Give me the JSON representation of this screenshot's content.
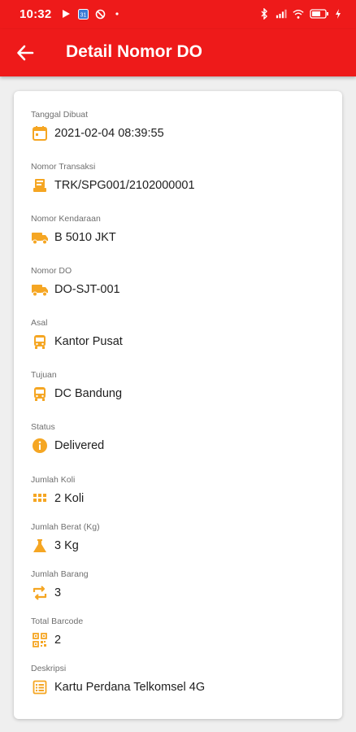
{
  "status_bar": {
    "time": "10:32",
    "left_icons": [
      "play-store-icon",
      "calendar-notification-icon",
      "block-icon",
      "dot-icon"
    ],
    "right_icons": [
      "bluetooth-icon",
      "signal-icon",
      "wifi-icon",
      "battery-icon",
      "charging-icon"
    ]
  },
  "app_bar": {
    "title": "Detail Nomor DO",
    "back_icon": "arrow-left-icon"
  },
  "colors": {
    "primary": "#ee1a1a",
    "icon_accent": "#f5a623",
    "label": "#6f6f6f",
    "value": "#1e1e1e"
  },
  "fields": [
    {
      "label": "Tanggal Dibuat",
      "value": "2021-02-04 08:39:55",
      "icon": "calendar-icon"
    },
    {
      "label": "Nomor Transaksi",
      "value": "TRK/SPG001/2102000001",
      "icon": "receipt-icon"
    },
    {
      "label": "Nomor Kendaraan",
      "value": "B 5010 JKT",
      "icon": "truck-icon"
    },
    {
      "label": "Nomor DO",
      "value": "DO-SJT-001",
      "icon": "truck-icon"
    },
    {
      "label": "Asal",
      "value": "Kantor Pusat",
      "icon": "bus-icon"
    },
    {
      "label": "Tujuan",
      "value": "DC Bandung",
      "icon": "bus-icon"
    },
    {
      "label": "Status",
      "value": "Delivered",
      "icon": "info-icon"
    },
    {
      "label": "Jumlah Koli",
      "value": "2 Koli",
      "icon": "grid-icon"
    },
    {
      "label": "Jumlah Berat (Kg)",
      "value": "3 Kg",
      "icon": "flask-icon"
    },
    {
      "label": "Jumlah Barang",
      "value": "3",
      "icon": "swap-icon"
    },
    {
      "label": "Total Barcode",
      "value": "2",
      "icon": "qr-code-icon"
    },
    {
      "label": "Deskripsi",
      "value": "Kartu Perdana Telkomsel 4G",
      "icon": "list-icon"
    }
  ]
}
